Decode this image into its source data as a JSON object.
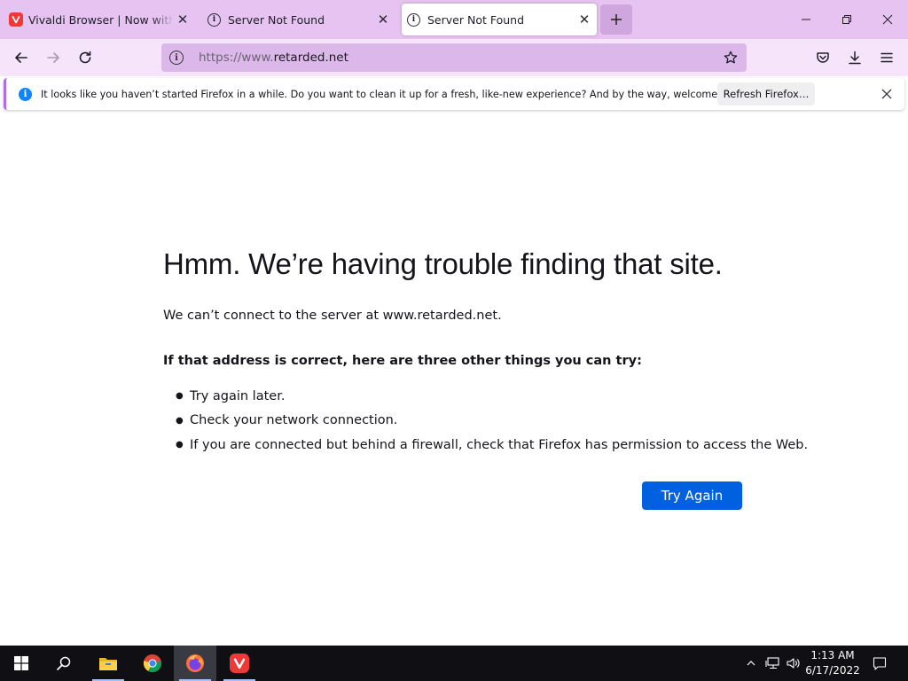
{
  "tabs": [
    {
      "title": "Vivaldi Browser | Now with built-in",
      "favicon": "vivaldi-logo",
      "active": false
    },
    {
      "title": "Server Not Found",
      "favicon": "info-icon",
      "active": false
    },
    {
      "title": "Server Not Found",
      "favicon": "info-icon",
      "active": true
    }
  ],
  "urlbar": {
    "scheme": "https://www.",
    "host": "retarded.net"
  },
  "notification": {
    "text": "It looks like you haven’t started Firefox in a while. Do you want to clean it up for a fresh, like-new experience? And by the way, welcome back!",
    "button_label": "Refresh Firefox…"
  },
  "error_page": {
    "title": "Hmm. We’re having trouble finding that site.",
    "description": "We can’t connect to the server at www.retarded.net.",
    "subheading": "If that address is correct, here are three other things you can try:",
    "suggestions": [
      "Try again later.",
      "Check your network connection.",
      "If you are connected but behind a firewall, check that Firefox has permission to access the Web."
    ],
    "try_again_label": "Try Again"
  },
  "taskbar": {
    "apps": [
      "start",
      "search",
      "file-explorer",
      "chrome",
      "firefox",
      "vivaldi"
    ],
    "clock_time": "1:13 AM",
    "clock_date": "6/17/2022"
  },
  "colors": {
    "tabstrip": "#e6c3f0",
    "navbar": "#f6e4fb",
    "urlbar": "#dcb7ea",
    "primary_button": "#0061e0",
    "info_blue": "#0a84ff",
    "taskbar": "#101014"
  }
}
